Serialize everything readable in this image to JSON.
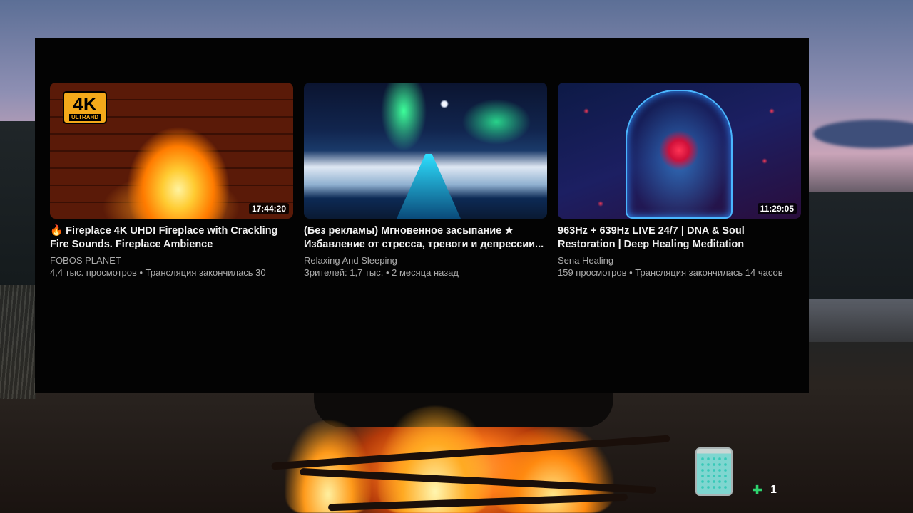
{
  "videos": [
    {
      "title": "🔥 Fireplace 4K UHD! Fireplace with Crackling Fire Sounds. Fireplace Ambience",
      "channel": "FOBOS PLANET",
      "meta": "4,4 тыс. просмотров • Трансляция закончилась 30",
      "duration": "17:44:20",
      "badge_big": "4K",
      "badge_small": "ULTRAHD"
    },
    {
      "title": "(Без рекламы) Мгновенное засыпание ★ Избавление от стресса, тревоги и депрессии...",
      "channel": "Relaxing And Sleeping",
      "meta": "Зрителей: 1,7 тыс. • 2 месяца назад",
      "duration": ""
    },
    {
      "title": "963Hz + 639Hz LIVE 24/7 | DNA & Soul Restoration | Deep Healing Meditation",
      "channel": "Sena Healing",
      "meta": "159 просмотров • Трансляция закончилась 14 часов",
      "duration": "11:29:05"
    }
  ],
  "extension": {
    "count": "1",
    "icon": "puzzle-icon"
  }
}
